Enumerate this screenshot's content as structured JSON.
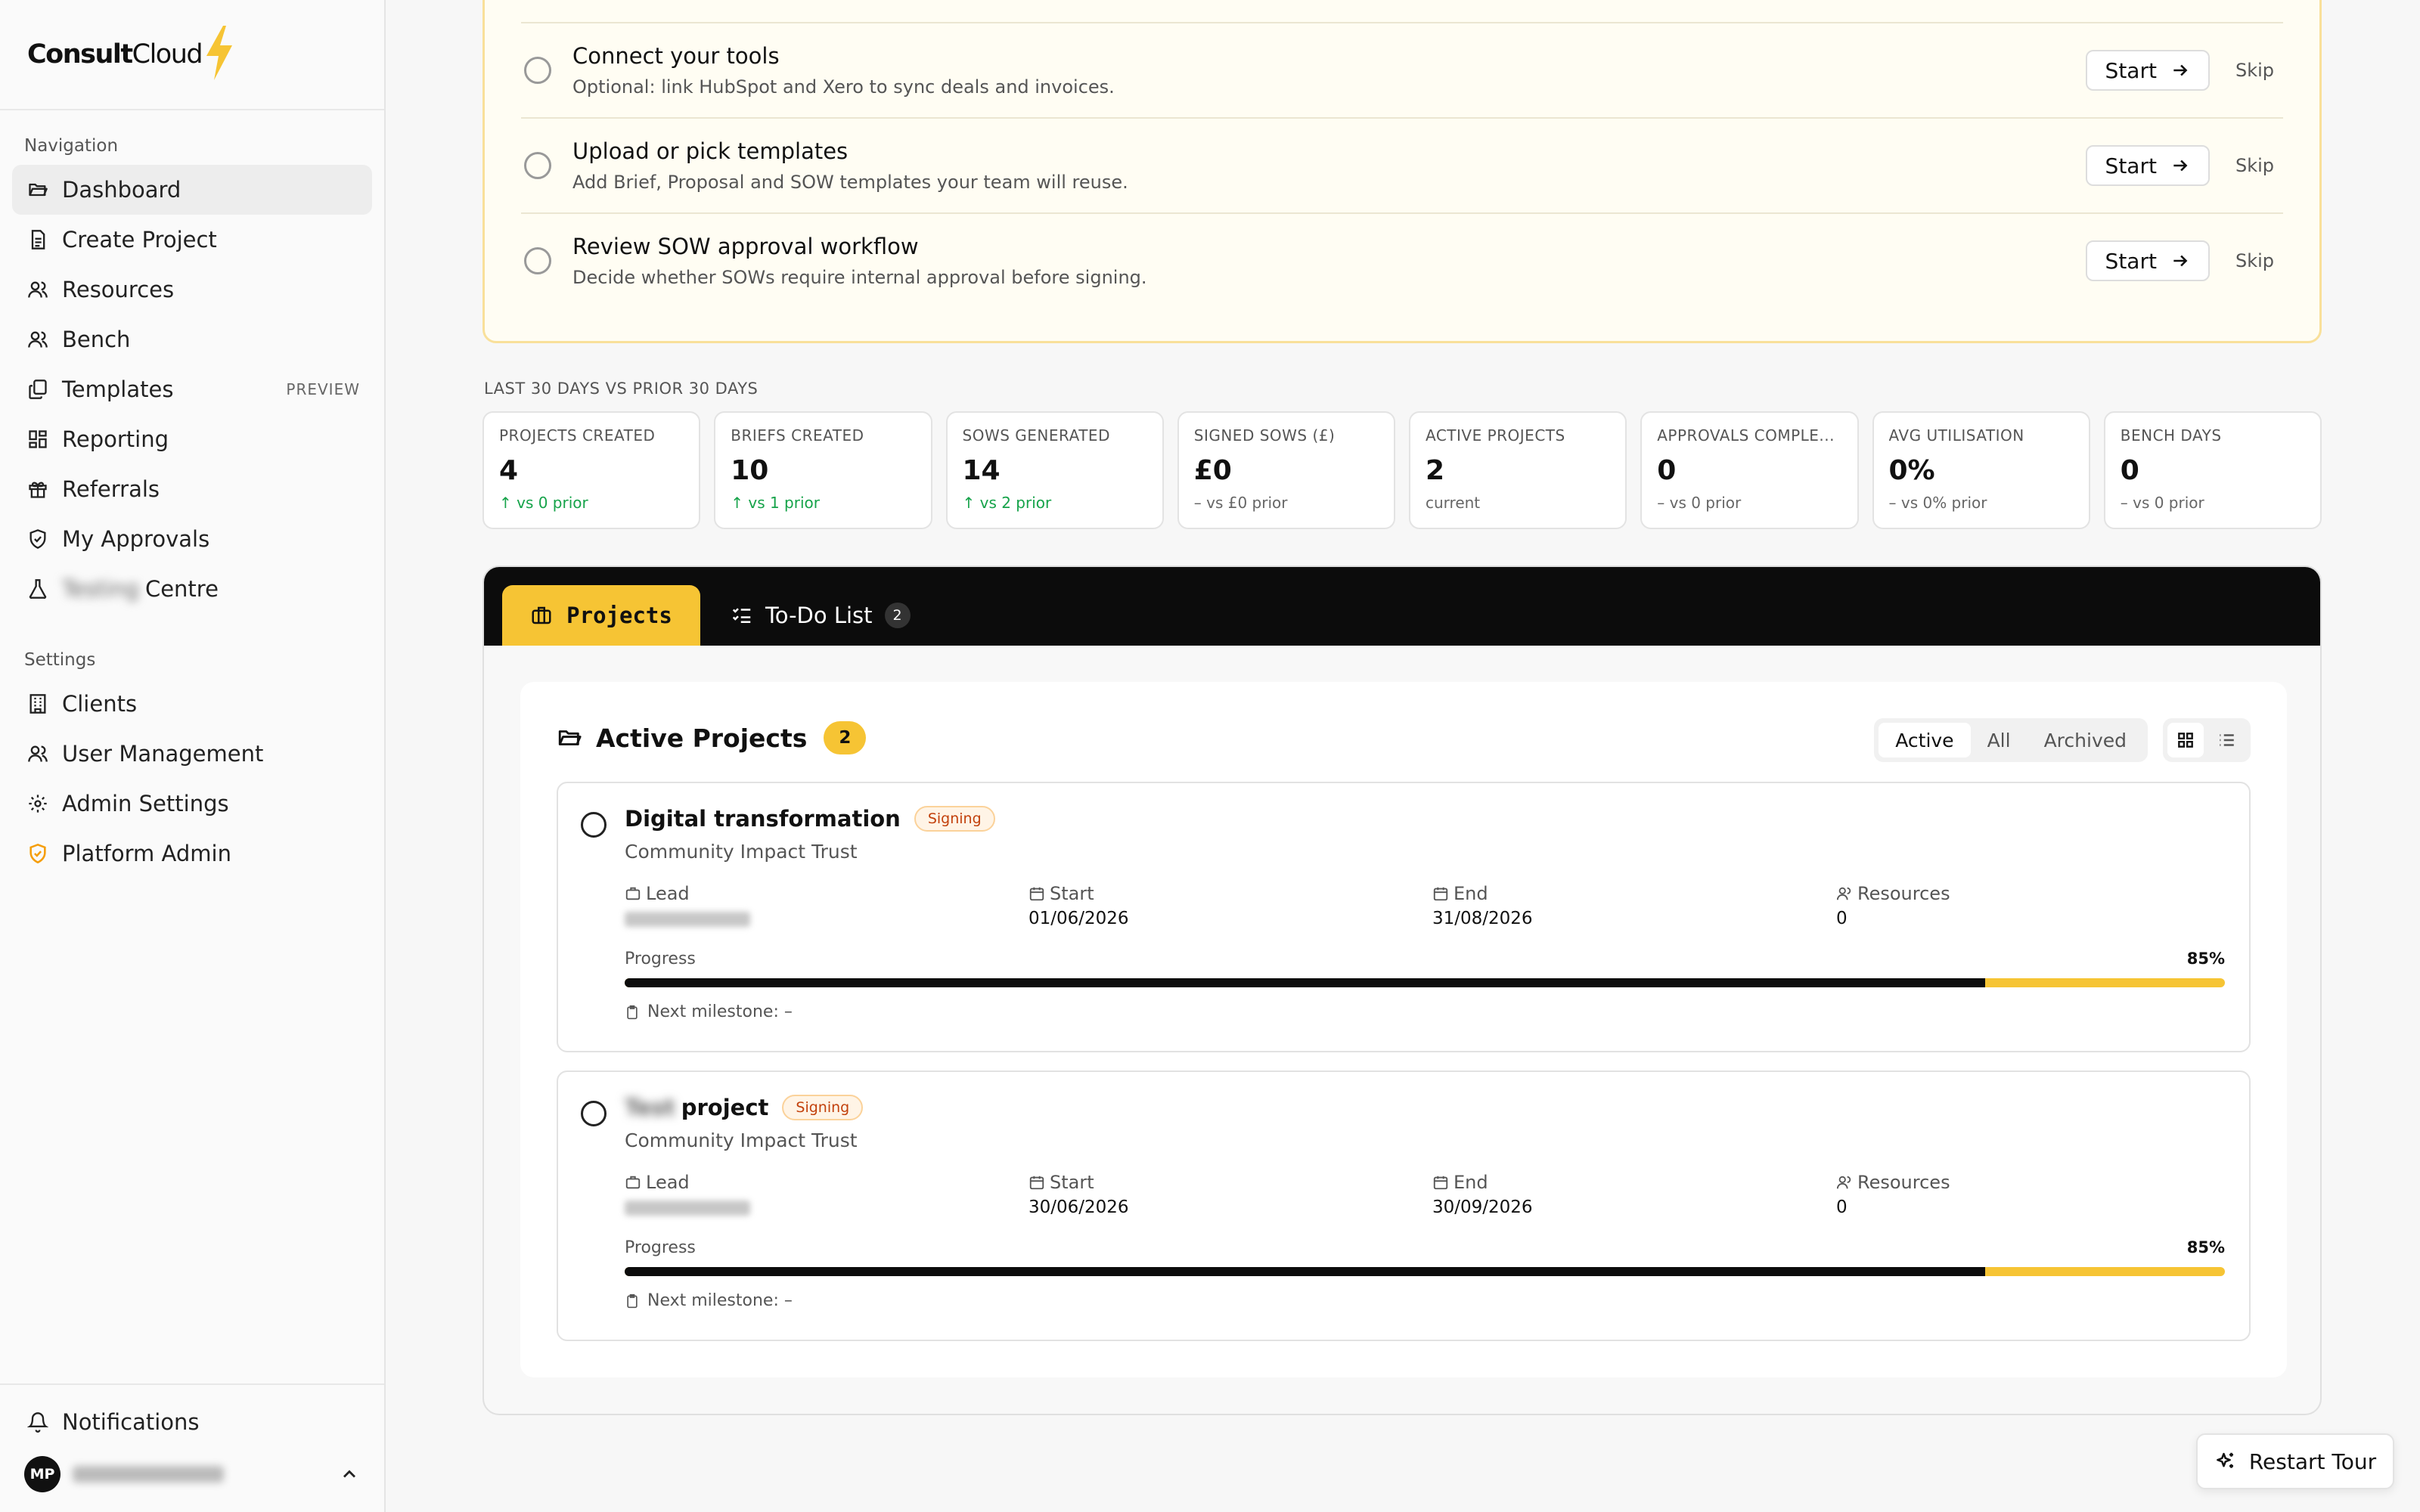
{
  "brand": {
    "name_bold": "Consult",
    "name_light": "Cloud",
    "accent": "#f6c434"
  },
  "nav": {
    "section_label": "Navigation",
    "items": [
      {
        "label": "Dashboard",
        "icon": "folder-open-icon",
        "active": true
      },
      {
        "label": "Create Project",
        "icon": "file-text-icon"
      },
      {
        "label": "Resources",
        "icon": "users-icon"
      },
      {
        "label": "Bench",
        "icon": "users-icon"
      },
      {
        "label": "Templates",
        "icon": "copy-icon",
        "badge": "PREVIEW"
      },
      {
        "label": "Reporting",
        "icon": "grid-icon"
      },
      {
        "label": "Referrals",
        "icon": "gift-icon"
      },
      {
        "label": "My Approvals",
        "icon": "shield-check-icon"
      },
      {
        "label": "Centre",
        "icon": "flask-icon"
      }
    ]
  },
  "settings": {
    "section_label": "Settings",
    "items": [
      {
        "label": "Clients",
        "icon": "building-icon"
      },
      {
        "label": "User Management",
        "icon": "users-icon"
      },
      {
        "label": "Admin Settings",
        "icon": "gear-icon"
      },
      {
        "label": "Platform Admin",
        "icon": "shield-icon"
      }
    ]
  },
  "footer": {
    "notifications": "Notifications",
    "avatar_initials": "MP"
  },
  "checklist": [
    {
      "title": "Connect your tools",
      "desc": "Optional: link HubSpot and Xero to sync deals and invoices.",
      "start": "Start",
      "skip": "Skip"
    },
    {
      "title": "Upload or pick templates",
      "desc": "Add Brief, Proposal and SOW templates your team will reuse.",
      "start": "Start",
      "skip": "Skip"
    },
    {
      "title": "Review SOW approval workflow",
      "desc": "Decide whether SOWs require internal approval before signing.",
      "start": "Start",
      "skip": "Skip"
    }
  ],
  "stats_caption": "LAST 30 DAYS VS PRIOR 30 DAYS",
  "stats": [
    {
      "label": "PROJECTS CREATED",
      "value": "4",
      "delta": "↑ vs 0 prior",
      "trend": "up"
    },
    {
      "label": "BRIEFS CREATED",
      "value": "10",
      "delta": "↑ vs 1 prior",
      "trend": "up"
    },
    {
      "label": "SOWS GENERATED",
      "value": "14",
      "delta": "↑ vs 2 prior",
      "trend": "up"
    },
    {
      "label": "SIGNED SOWS (£)",
      "value": "£0",
      "delta": "– vs £0 prior",
      "trend": "flat"
    },
    {
      "label": "ACTIVE PROJECTS",
      "value": "2",
      "delta": "current",
      "trend": "flat"
    },
    {
      "label": "APPROVALS COMPLE...",
      "value": "0",
      "delta": "– vs 0 prior",
      "trend": "flat"
    },
    {
      "label": "AVG UTILISATION",
      "value": "0%",
      "delta": "– vs 0% prior",
      "trend": "flat"
    },
    {
      "label": "BENCH DAYS",
      "value": "0",
      "delta": "– vs 0 prior",
      "trend": "flat"
    }
  ],
  "tabs": {
    "projects": "Projects",
    "todo": "To-Do List",
    "todo_count": "2"
  },
  "active_projects": {
    "title": "Active Projects",
    "count": "2",
    "filters": [
      "Active",
      "All",
      "Archived"
    ],
    "selected_filter": "Active"
  },
  "projects": [
    {
      "name": "Digital transformation",
      "status": "Signing",
      "client": "Community Impact Trust",
      "lead_label": "Lead",
      "start_label": "Start",
      "start": "01/06/2026",
      "end_label": "End",
      "end": "31/08/2026",
      "resources_label": "Resources",
      "resources": "0",
      "progress_label": "Progress",
      "progress_text": "85%",
      "progress": 85,
      "milestone": "Next milestone: –"
    },
    {
      "name": "project",
      "status": "Signing",
      "client": "Community Impact Trust",
      "lead_label": "Lead",
      "start_label": "Start",
      "start": "30/06/2026",
      "end_label": "End",
      "end": "30/09/2026",
      "resources_label": "Resources",
      "resources": "0",
      "progress_label": "Progress",
      "progress_text": "85%",
      "progress": 85,
      "milestone": "Next milestone: –"
    }
  ],
  "restart_tour": "Restart Tour"
}
